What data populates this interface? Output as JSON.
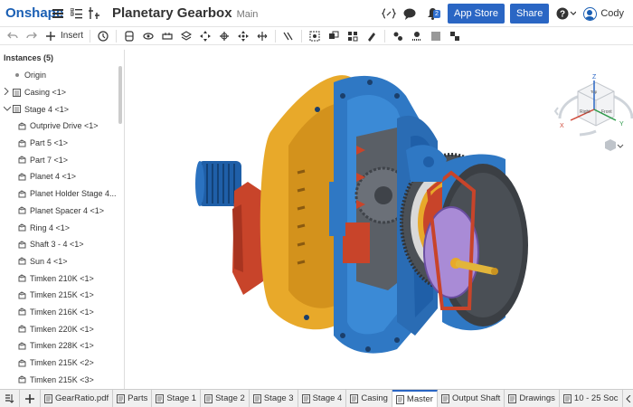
{
  "header": {
    "logo": "Onshape",
    "title": "Planetary Gearbox",
    "branch": "Main",
    "notification_count": "2",
    "app_store_label": "App Store",
    "share_label": "Share",
    "help_label": "?",
    "user_name": "Cody"
  },
  "toolbar": {
    "insert_label": "Insert"
  },
  "panel": {
    "title": "Instances (5)",
    "items": [
      {
        "label": "Origin"
      },
      {
        "label": "Casing <1>"
      },
      {
        "label": "Stage 4 <1>"
      },
      {
        "label": "Outprive Drive <1>"
      },
      {
        "label": "Part 5 <1>"
      },
      {
        "label": "Part 7 <1>"
      },
      {
        "label": "Planet 4 <1>"
      },
      {
        "label": "Planet Holder Stage 4..."
      },
      {
        "label": "Planet Spacer 4 <1>"
      },
      {
        "label": "Ring 4 <1>"
      },
      {
        "label": "Shaft 3 - 4 <1>"
      },
      {
        "label": "Sun 4 <1>"
      },
      {
        "label": "Timken 210K <1>"
      },
      {
        "label": "Timken 215K <1>"
      },
      {
        "label": "Timken 216K <1>"
      },
      {
        "label": "Timken 220K <1>"
      },
      {
        "label": "Timken 228K <1>"
      },
      {
        "label": "Timken 215K <2>"
      },
      {
        "label": "Timken 215K <3>"
      }
    ]
  },
  "view_cube": {
    "z": "Z",
    "x": "X",
    "y": "Y",
    "top": "Top",
    "right": "Right",
    "front": "Front"
  },
  "tabs": [
    {
      "label": "GearRatio.pdf"
    },
    {
      "label": "Parts"
    },
    {
      "label": "Stage 1"
    },
    {
      "label": "Stage 2"
    },
    {
      "label": "Stage 3"
    },
    {
      "label": "Stage 4"
    },
    {
      "label": "Casing"
    },
    {
      "label": "Master"
    },
    {
      "label": "Output Shaft"
    },
    {
      "label": "Drawings"
    },
    {
      "label": "10 - 25 Soc"
    }
  ],
  "colors": {
    "brand": "#1a5fb4",
    "accent": "#2a66c4",
    "casing_yellow": "#e8a92a",
    "casing_blue": "#2f78c4",
    "gear_grey": "#5a5f66",
    "ring_red": "#d1482b",
    "purple": "#a98bd6"
  }
}
